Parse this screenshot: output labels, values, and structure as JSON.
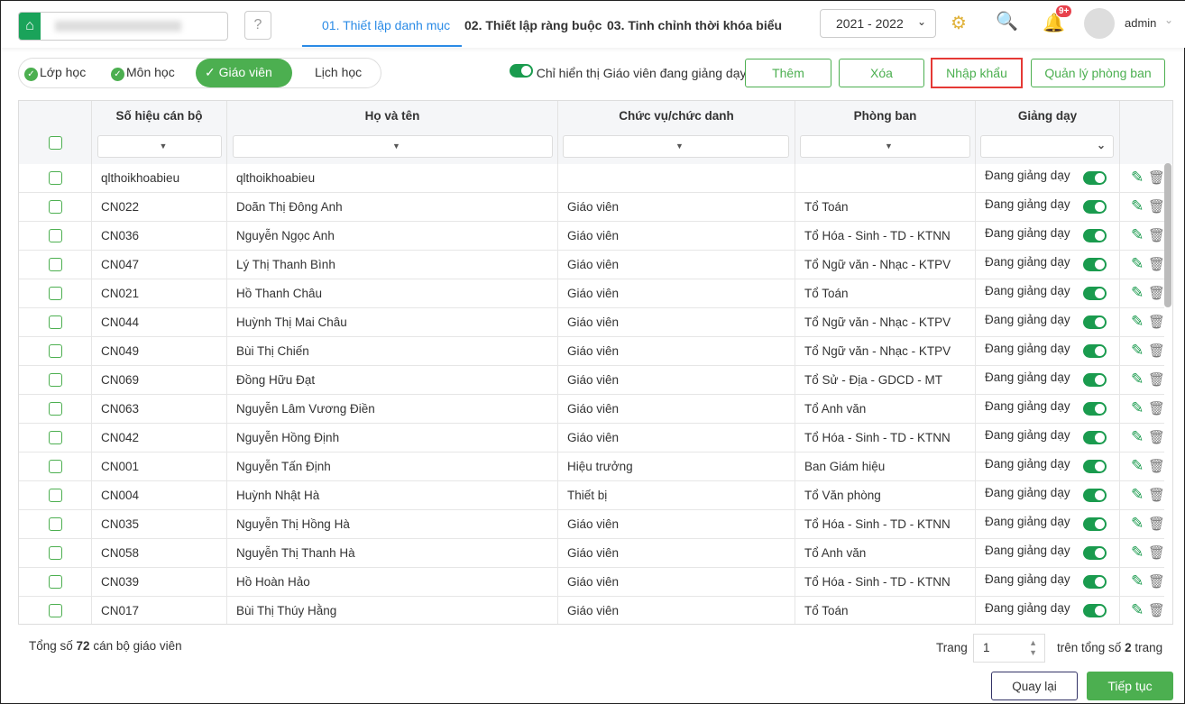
{
  "header": {
    "steps": [
      "01. Thiết lập danh mục",
      "02. Thiết lập ràng buộc",
      "03. Tinh chỉnh thời khóa biểu"
    ],
    "year": "2021 - 2022",
    "notif_badge": "9+",
    "user": "admin"
  },
  "filters": {
    "items": [
      "Lớp học",
      "Môn học",
      "Giáo viên",
      "Lịch học"
    ],
    "selected": "Giáo viên",
    "toggle_label": "Chỉ hiển thị Giáo viên đang giảng dạy",
    "toggle_on": true
  },
  "actions": {
    "add": "Thêm",
    "delete": "Xóa",
    "import": "Nhập khẩu",
    "manage": "Quản lý phòng ban"
  },
  "colors": {
    "accent": "#4caf50",
    "brand": "#1aa35a",
    "active_step": "#2b8be6",
    "highlight": "#e53935"
  },
  "table": {
    "columns": [
      "Số hiệu cán bộ",
      "Họ và tên",
      "Chức vụ/chức danh",
      "Phòng ban",
      "Giảng dạy"
    ],
    "rows": [
      [
        "qlthoikhoabieu",
        "qlthoikhoabieu",
        "",
        "",
        "Đang giảng dạy"
      ],
      [
        "CN022",
        "Doãn Thị Đông Anh",
        "Giáo viên",
        "Tổ Toán",
        "Đang giảng dạy"
      ],
      [
        "CN036",
        "Nguyễn Ngọc Anh",
        "Giáo viên",
        "Tổ Hóa - Sinh - TD - KTNN",
        "Đang giảng dạy"
      ],
      [
        "CN047",
        "Lý Thị Thanh Bình",
        "Giáo viên",
        "Tổ Ngữ văn - Nhạc - KTPV",
        "Đang giảng dạy"
      ],
      [
        "CN021",
        "Hồ Thanh Châu",
        "Giáo viên",
        "Tổ Toán",
        "Đang giảng dạy"
      ],
      [
        "CN044",
        "Huỳnh Thị Mai Châu",
        "Giáo viên",
        "Tổ Ngữ văn - Nhạc - KTPV",
        "Đang giảng dạy"
      ],
      [
        "CN049",
        "Bùi Thị Chiến",
        "Giáo viên",
        "Tổ Ngữ văn - Nhạc - KTPV",
        "Đang giảng dạy"
      ],
      [
        "CN069",
        "Đồng Hữu Đạt",
        "Giáo viên",
        "Tổ Sử - Địa - GDCD - MT",
        "Đang giảng dạy"
      ],
      [
        "CN063",
        "Nguyễn Lâm Vương Điền",
        "Giáo viên",
        "Tổ Anh văn",
        "Đang giảng dạy"
      ],
      [
        "CN042",
        "Nguyễn Hồng Định",
        "Giáo viên",
        "Tổ Hóa - Sinh - TD - KTNN",
        "Đang giảng dạy"
      ],
      [
        "CN001",
        "Nguyễn Tấn Định",
        "Hiệu trưởng",
        "Ban Giám hiệu",
        "Đang giảng dạy"
      ],
      [
        "CN004",
        "Huỳnh Nhật Hà",
        "Thiết bị",
        "Tổ Văn phòng",
        "Đang giảng dạy"
      ],
      [
        "CN035",
        "Nguyễn Thị Hồng Hà",
        "Giáo viên",
        "Tổ Hóa - Sinh - TD - KTNN",
        "Đang giảng dạy"
      ],
      [
        "CN058",
        "Nguyễn Thị Thanh Hà",
        "Giáo viên",
        "Tổ Anh văn",
        "Đang giảng dạy"
      ],
      [
        "CN039",
        "Hồ Hoàn Hảo",
        "Giáo viên",
        "Tổ Hóa - Sinh - TD - KTNN",
        "Đang giảng dạy"
      ],
      [
        "CN017",
        "Bùi Thị Thúy Hằng",
        "Giáo viên",
        "Tổ Toán",
        "Đang giảng dạy"
      ]
    ]
  },
  "footer": {
    "total_prefix": "Tổng số",
    "total": "72",
    "total_suffix": "cán bộ giáo viên",
    "page_label": "Trang",
    "page": "1",
    "of_prefix": "trên tổng số",
    "pages": "2",
    "of_suffix": "trang",
    "back": "Quay lại",
    "next": "Tiếp tục"
  }
}
